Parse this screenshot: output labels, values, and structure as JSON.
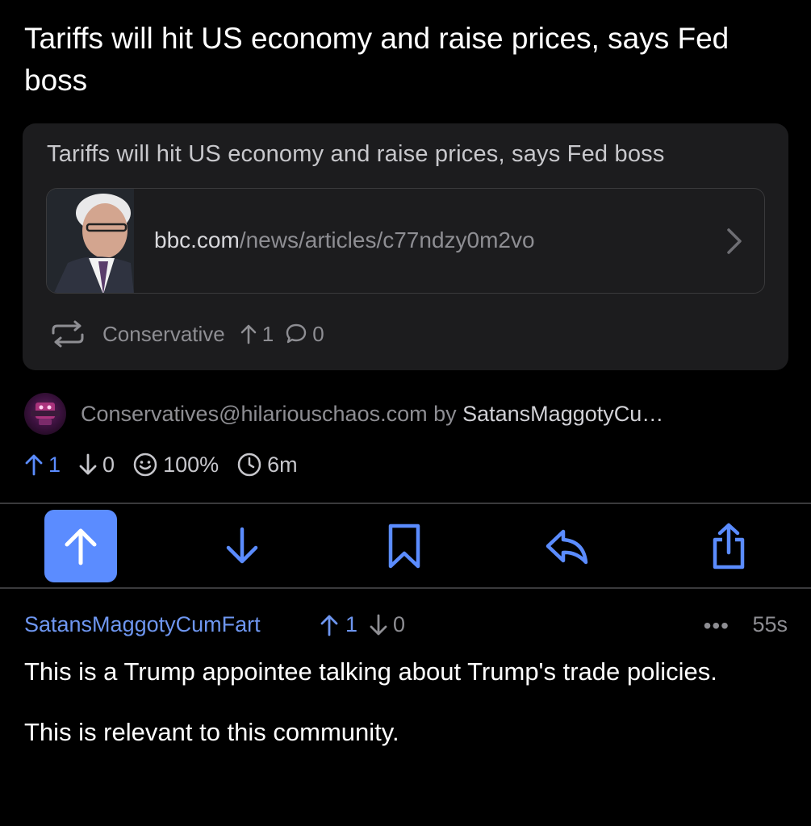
{
  "post": {
    "title": "Tariffs will hit US economy and raise prices, says Fed boss"
  },
  "crosspost": {
    "title": "Tariffs will hit US economy and raise prices, says Fed boss",
    "link": {
      "domain": "bbc.com",
      "path": "/news/articles/c77ndzy0m2vo",
      "thumbnail_icon": "article-thumbnail",
      "chevron_icon": "chevron-right-icon"
    },
    "meta": {
      "crosspost_icon": "repost-icon",
      "community": "Conservative",
      "upvotes": "1",
      "comments": "0"
    }
  },
  "author": {
    "community": "Conservatives@hilariouschaos.com",
    "by_label": " by ",
    "user": "SatansMaggotyCu…"
  },
  "stats": {
    "upvotes": "1",
    "downvotes": "0",
    "ratio": "100%",
    "age": "6m"
  },
  "actions": [
    {
      "name": "upvote",
      "icon": "arrow-up-icon",
      "active": true
    },
    {
      "name": "downvote",
      "icon": "arrow-down-icon",
      "active": false
    },
    {
      "name": "save",
      "icon": "bookmark-icon",
      "active": false
    },
    {
      "name": "reply",
      "icon": "reply-icon",
      "active": false
    },
    {
      "name": "share",
      "icon": "share-icon",
      "active": false
    }
  ],
  "comment": {
    "user": "SatansMaggotyCumFart",
    "upvotes": "1",
    "downvotes": "0",
    "more": "•••",
    "age": "55s",
    "paragraphs": [
      "This is a Trump appointee talking about Trump's trade policies.",
      "This is relevant to this community."
    ]
  },
  "colors": {
    "background": "#000000",
    "card": "#1c1c1e",
    "accent": "#5b8cff",
    "muted": "#8e8e93"
  }
}
